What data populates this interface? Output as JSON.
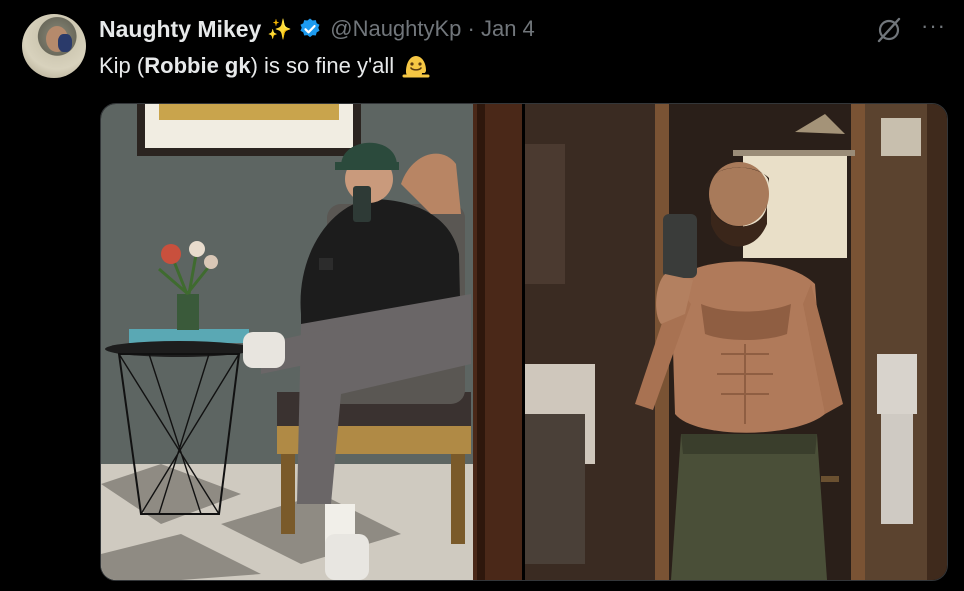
{
  "tweet": {
    "author_name": "Naughty Mikey",
    "sparkle_emoji": "✨",
    "handle_date": "@NaughtyKp · Jan 4",
    "text_before": "Kip (",
    "text_bold": "Robbie gk",
    "text_after": ") is so fine y'all",
    "more_label": "···"
  },
  "colors": {
    "background": "#000000",
    "text": "#e7e9ea",
    "secondary": "#71767b",
    "verified": "#1d9bf0"
  },
  "icons": [
    "avatar",
    "sparkles-icon",
    "verified-badge-icon",
    "grok-icon",
    "more-icon",
    "melting-face-emoji"
  ]
}
